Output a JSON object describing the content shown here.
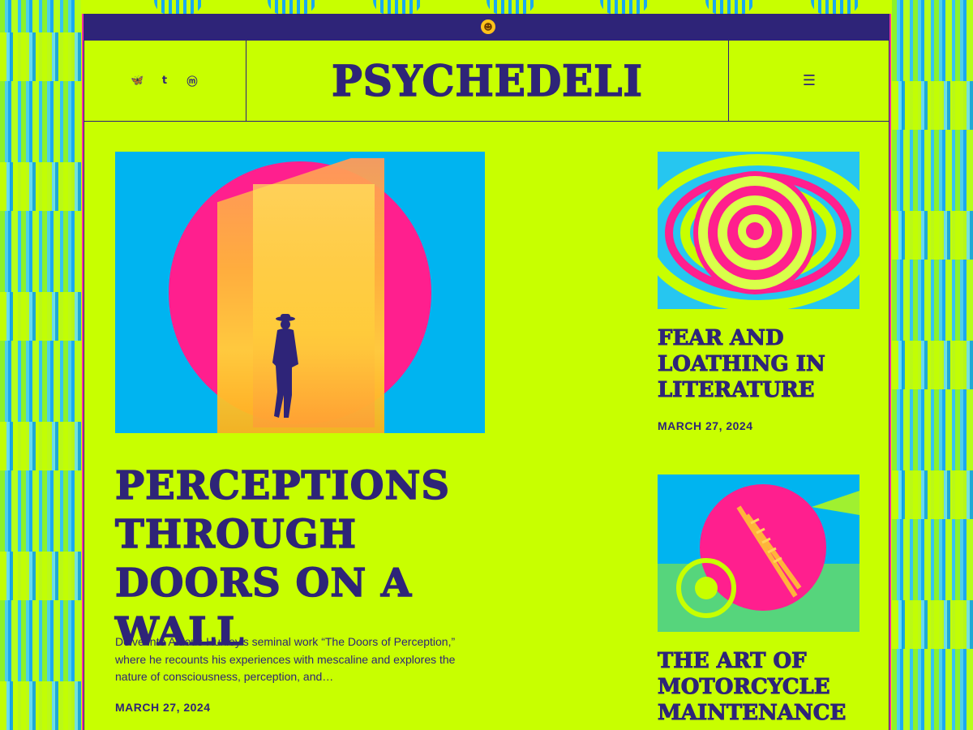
{
  "site": {
    "logo": "PSYCHEDELI",
    "smiley_glyph": "☻"
  },
  "social": [
    {
      "name": "bluesky",
      "glyph": "🦋"
    },
    {
      "name": "tumblr",
      "glyph": "t"
    },
    {
      "name": "mastodon",
      "glyph": "ⓜ"
    }
  ],
  "menu": {
    "glyph": "☰"
  },
  "feature": {
    "title": "PERCEPTIONS THROUGH DOORS ON A WALL",
    "excerpt": "Delve into Aldous Huxley’s seminal work “The Doors of Perception,” where he recounts his experiences with mescaline and explores the nature of consciousness, perception, and…",
    "date": "MARCH 27, 2024"
  },
  "posts": [
    {
      "title": "FEAR AND LOATHING IN LITERATURE",
      "date": "MARCH 27, 2024"
    },
    {
      "title": "THE ART OF MOTORCYCLE MAINTENANCE",
      "date": ""
    }
  ],
  "colors": {
    "ink": "#2e2478",
    "lime": "#c8ff00",
    "pink": "#ff1f8e",
    "cyan": "#00b4f0",
    "border_pink": "#ff2fa0"
  }
}
